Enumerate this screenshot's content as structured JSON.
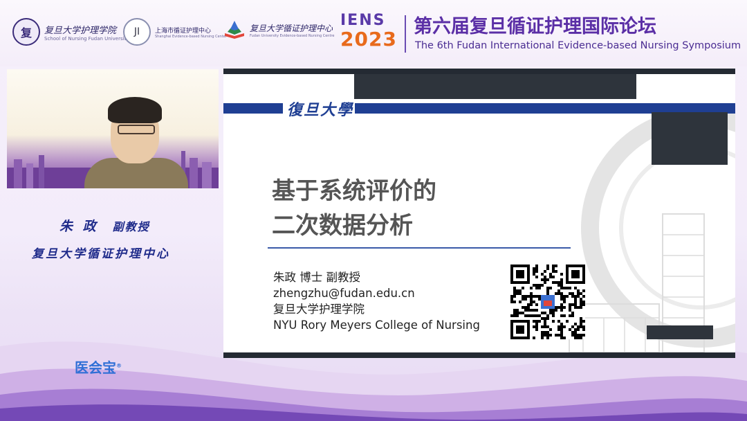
{
  "header": {
    "logo1": {
      "text": "复旦大学护理学院",
      "subtext": "School of Nursing Fudan University",
      "seal": "复"
    },
    "logo2": {
      "text": "上海市循证护理中心",
      "subtext": "Shanghai Evidence-based Nursing Center",
      "mark": "JI"
    },
    "logo3": {
      "text": "复旦大学循证护理中心",
      "subtext": "Fudan University Evidence-based Nursing Centre"
    },
    "ens_label": "IENS",
    "ens_year": "2023",
    "title_cn": "第六届复旦循证护理国际论坛",
    "title_en": "The 6th Fudan International Evidence-based Nursing Symposium"
  },
  "speaker": {
    "name": "朱 政",
    "title": "副教授",
    "org": "复旦大学循证护理中心"
  },
  "brand": {
    "name": "医会宝",
    "mark": "®"
  },
  "slide": {
    "fudan_script": "復旦大學",
    "title_line1": "基于系统评价的",
    "title_line2": "二次数据分析",
    "info": [
      "朱政  博士  副教授",
      "zhengzhu@fudan.edu.cn",
      "复旦大学护理学院",
      "NYU Rory Meyers College of Nursing"
    ]
  },
  "colors": {
    "accent_purple": "#5b2fa6",
    "accent_orange": "#e86a1c",
    "slide_blue": "#1f3f93",
    "speaker_blue": "#1e2a8a",
    "brand_blue": "#2f6fd6"
  }
}
